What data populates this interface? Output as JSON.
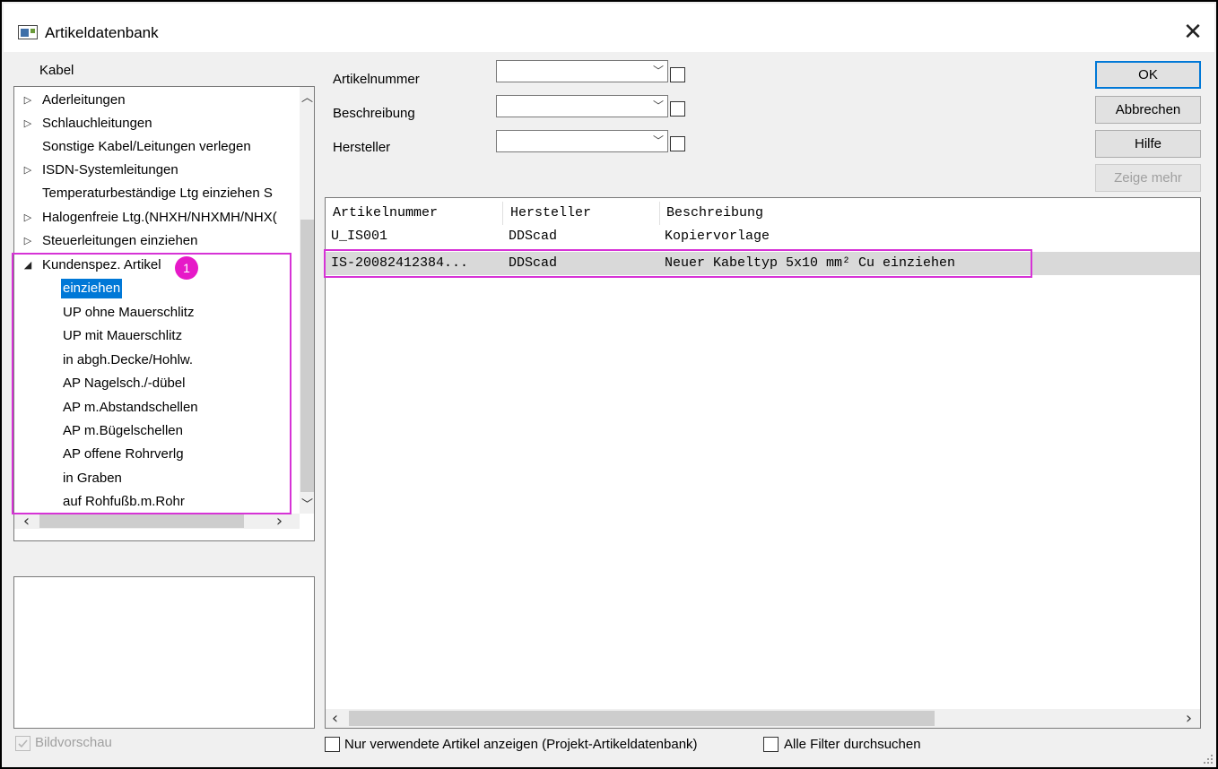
{
  "window": {
    "title": "Artikeldatenbank",
    "close_glyph": "✕"
  },
  "tree_panel": {
    "header": "Kabel",
    "nodes": [
      {
        "label": "Aderleitungen",
        "expander": "▷"
      },
      {
        "label": "Schlauchleitungen",
        "expander": "▷"
      },
      {
        "label": "Sonstige Kabel/Leitungen verlegen",
        "expander": ""
      },
      {
        "label": "ISDN-Systemleitungen",
        "expander": "▷"
      },
      {
        "label": "Temperaturbeständige Ltg einziehen S",
        "expander": ""
      },
      {
        "label": "Halogenfreie Ltg.(NHXH/NHXMH/NHX(",
        "expander": "▷"
      },
      {
        "label": "Steuerleitungen einziehen",
        "expander": "▷"
      },
      {
        "label": "Kundenspez. Artikel",
        "expander": "◢"
      }
    ],
    "children": [
      {
        "label": "einziehen",
        "selected": true
      },
      {
        "label": "UP ohne Mauerschlitz"
      },
      {
        "label": "UP mit Mauerschlitz"
      },
      {
        "label": "in abgh.Decke/Hohlw."
      },
      {
        "label": "AP Nagelsch./-dübel"
      },
      {
        "label": "AP m.Abstandschellen"
      },
      {
        "label": "AP m.Bügelschellen"
      },
      {
        "label": "AP offene Rohrverlg"
      },
      {
        "label": "in Graben"
      },
      {
        "label": "auf Rohfußb.m.Rohr"
      }
    ],
    "badge": "1"
  },
  "preview": {
    "label": "Bildvorschau",
    "checked": true,
    "enabled": false
  },
  "filters": {
    "article_number": {
      "label": "Artikelnummer",
      "value": ""
    },
    "description": {
      "label": "Beschreibung",
      "value": ""
    },
    "manufacturer": {
      "label": "Hersteller",
      "value": ""
    },
    "caret": "﹀"
  },
  "buttons": {
    "ok": "OK",
    "cancel": "Abbrechen",
    "help": "Hilfe",
    "show_more": "Zeige mehr"
  },
  "results": {
    "columns": [
      "Artikelnummer",
      "Hersteller",
      "Beschreibung"
    ],
    "rows": [
      [
        "U_IS001",
        "DDScad",
        "Kopiervorlage"
      ],
      [
        "IS-20082412384...",
        "DDScad",
        "Neuer Kabeltyp 5x10 mm² Cu einziehen"
      ]
    ],
    "selected_row": 1
  },
  "footer": {
    "only_used": "Nur verwendete Artikel anzeigen (Projekt-Artikeldatenbank)",
    "search_all": "Alle Filter durchsuchen"
  },
  "scroll": {
    "up": "︿",
    "down": "﹀",
    "left": "‹",
    "right": "›"
  },
  "colors": {
    "highlight": "#d633d6",
    "badge": "#e619c8",
    "selection": "#0078d7",
    "row_selection": "#d9d9d9"
  }
}
